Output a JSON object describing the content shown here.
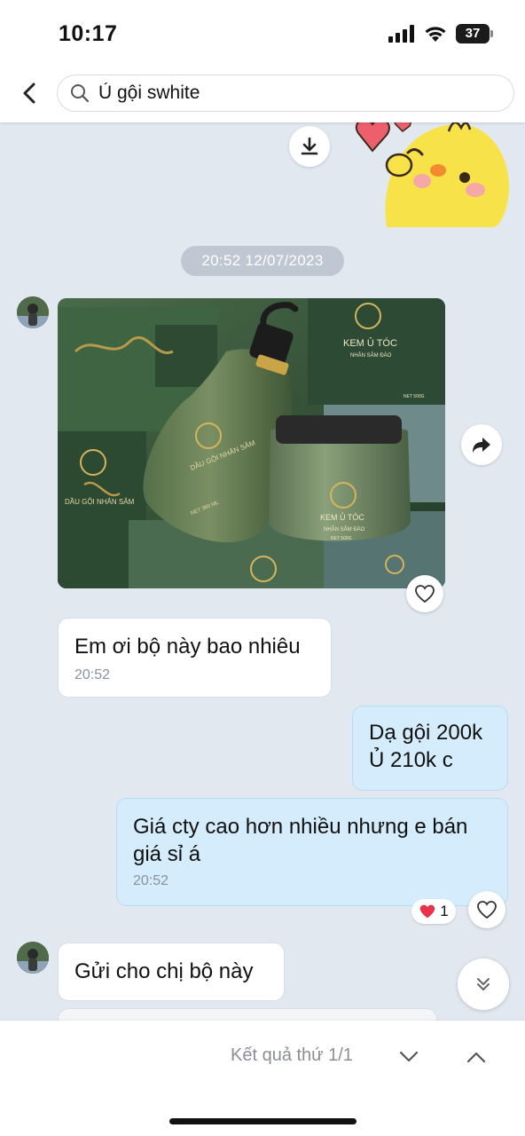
{
  "status_bar": {
    "time": "10:17",
    "battery": "37"
  },
  "header": {
    "search_value": "Ủ gội swhite"
  },
  "chat": {
    "date_separator": "20:52 12/07/2023",
    "messages": [
      {
        "direction": "in",
        "text": "Em ơi bộ này bao nhiêu",
        "time": "20:52"
      },
      {
        "direction": "out",
        "line1": "Dạ gội 200k",
        "line2": "Ủ 210k c"
      },
      {
        "direction": "out",
        "line1": "Giá cty cao hơn nhiều nhưng e bán",
        "line2": "giá sỉ á",
        "time": "20:52",
        "reaction_count": "1"
      },
      {
        "direction": "in",
        "text": "Gửi cho chị bộ này"
      }
    ],
    "photo_labels": {
      "box_brand": "KEM Ủ TÓC",
      "box_sub": "NHÂN SÂM ĐÀO",
      "box_net": "NET 500G",
      "bottle_name": "DẦU GỘI NHÂN SÂM",
      "bottle_net": "NET 380 ML",
      "jar_name": "KEM Ủ TÓC",
      "jar_sub": "NHÂN SÂM ĐÀO",
      "jar_net": "NET 500G",
      "side_box": "DẦU GỘI NHÂN SÂM",
      "logo": "WHITE"
    }
  },
  "bottom_bar": {
    "result_text": "Kết quả thứ 1/1"
  },
  "colors": {
    "bubble_out": "#d4ecfb",
    "bubble_in": "#ffffff",
    "background": "#e2e8f0",
    "product_green": "#3d5c3c",
    "heart": "#e8334a"
  }
}
